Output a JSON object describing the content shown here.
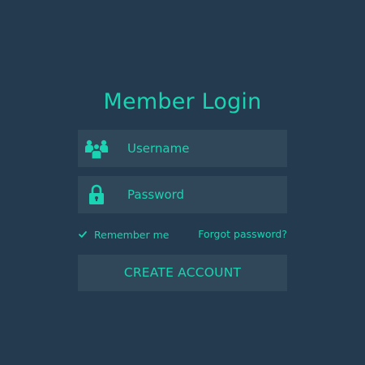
{
  "login": {
    "title": "Member Login",
    "username_placeholder": "Username",
    "password_placeholder": "Password",
    "remember_label": "Remember me",
    "forgot_label": "Forgot password?",
    "create_label": "CREATE ACCOUNT"
  },
  "icons": {
    "username": "users-group-icon",
    "password": "lock-icon",
    "remember": "checkmark-icon"
  },
  "colors": {
    "background": "#243a4f",
    "field_background": "#2f4759",
    "accent": "#19d3b2"
  }
}
